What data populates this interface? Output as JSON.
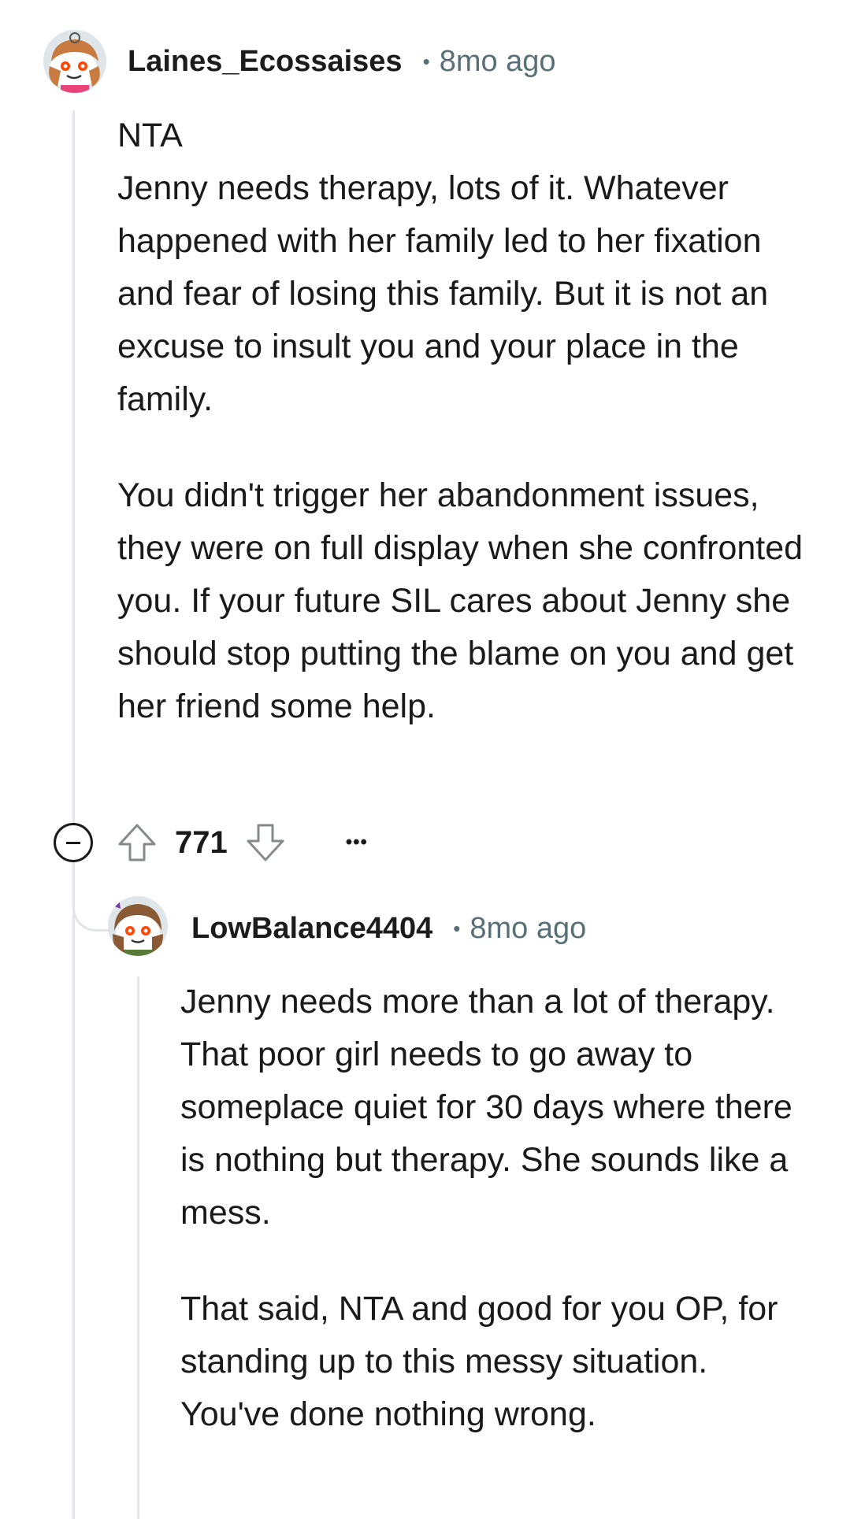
{
  "comments": [
    {
      "username": "Laines_Ecossaises",
      "separator": "•",
      "time": "8mo ago",
      "paragraphs": [
        "NTA\nJenny needs therapy, lots of it. Whatever happened with her family led to her fixation and fear of losing this family. But it is not an excuse to insult you and your place in the family.",
        "You didn't trigger her abandonment issues, they were on full display when she confronted you. If your future SIL cares about Jenny she should stop putting the blame on you and get her friend some help."
      ],
      "votes": "771",
      "more": "•••"
    },
    {
      "username": "LowBalance4404",
      "separator": "•",
      "time": "8mo ago",
      "paragraphs": [
        "Jenny needs more than a lot of therapy. That poor girl needs to go away to someplace quiet for 30 days where there is nothing but therapy. She sounds like a mess.",
        "That said, NTA and good for you OP, for standing up to this messy situation. You've done nothing wrong."
      ]
    }
  ],
  "icons": {
    "collapse": "collapse-icon",
    "upvote": "upvote-arrow-icon",
    "downvote": "downvote-arrow-icon",
    "more": "more-options-icon"
  },
  "colors": {
    "text": "#1a1a1b",
    "meta": "#576f76",
    "thread_line": "#e3e5e8"
  }
}
